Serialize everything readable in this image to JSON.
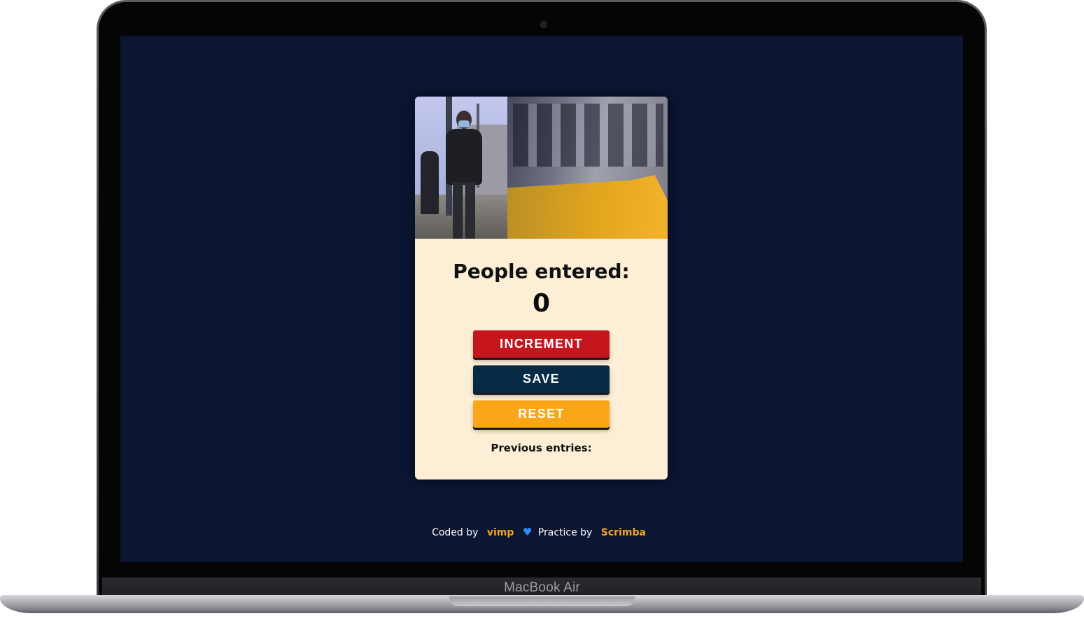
{
  "device": {
    "brand_label": "MacBook Air"
  },
  "app": {
    "title": "People entered:",
    "count": "0",
    "buttons": {
      "increment": "INCREMENT",
      "save": "SAVE",
      "reset": "RESET"
    },
    "previous_entries_label": "Previous entries:",
    "previous_entries_value": "",
    "hero_image": "person-wearing-mask-on-train-platform"
  },
  "footer": {
    "coded_by_label": "Coded by",
    "author": "vimp",
    "heart_icon": "heart-icon",
    "practice_by_label": "Practice by",
    "platform": "Scrimba"
  },
  "colors": {
    "page_background": "#0c1633",
    "card_background": "#fdefd5",
    "increment_button": "#c4161c",
    "save_button": "#062a45",
    "reset_button": "#fba616",
    "footer_accent": "#f2a51e",
    "heart": "#2e8ff0"
  }
}
